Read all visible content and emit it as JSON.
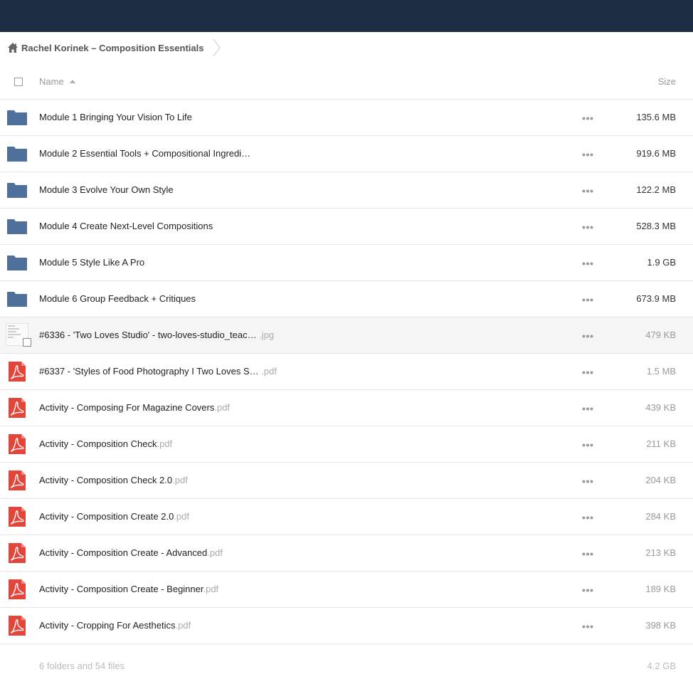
{
  "breadcrumb": {
    "label": "Rachel Korinek – Composition Essentials"
  },
  "header": {
    "name_label": "Name",
    "size_label": "Size"
  },
  "items": [
    {
      "kind": "folder",
      "name": "Module 1 Bringing Your Vision To Life",
      "ext": "",
      "size": "135.6 MB"
    },
    {
      "kind": "folder",
      "name": "Module 2 Essential Tools + Compositional Ingredi…",
      "ext": "",
      "size": "919.6 MB"
    },
    {
      "kind": "folder",
      "name": "Module 3 Evolve Your Own Style",
      "ext": "",
      "size": "122.2 MB"
    },
    {
      "kind": "folder",
      "name": "Module 4 Create Next-Level Compositions",
      "ext": "",
      "size": "528.3 MB"
    },
    {
      "kind": "folder",
      "name": "Module 5 Style Like A Pro",
      "ext": "",
      "size": "1.9 GB"
    },
    {
      "kind": "folder",
      "name": "Module 6 Group Feedback + Critiques",
      "ext": "",
      "size": "673.9 MB"
    },
    {
      "kind": "image",
      "name": "#6336 - 'Two Loves Studio' - two-loves-studio_teac… ",
      "ext": ".jpg",
      "size": "479 KB"
    },
    {
      "kind": "pdf",
      "name": "#6337 - 'Styles of Food Photography I Two Loves S… ",
      "ext": ".pdf",
      "size": "1.5 MB"
    },
    {
      "kind": "pdf",
      "name": "Activity - Composing For Magazine Covers",
      "ext": ".pdf",
      "size": "439 KB"
    },
    {
      "kind": "pdf",
      "name": "Activity - Composition Check",
      "ext": ".pdf",
      "size": "211 KB"
    },
    {
      "kind": "pdf",
      "name": "Activity - Composition Check 2.0",
      "ext": ".pdf",
      "size": "204 KB"
    },
    {
      "kind": "pdf",
      "name": "Activity - Composition Create 2.0",
      "ext": ".pdf",
      "size": "284 KB"
    },
    {
      "kind": "pdf",
      "name": "Activity - Composition Create - Advanced",
      "ext": ".pdf",
      "size": "213 KB"
    },
    {
      "kind": "pdf",
      "name": "Activity - Composition Create - Beginner",
      "ext": ".pdf",
      "size": "189 KB"
    },
    {
      "kind": "pdf",
      "name": "Activity - Cropping For Aesthetics",
      "ext": ".pdf",
      "size": "398 KB"
    }
  ],
  "footer": {
    "summary": "6 folders and 54 files",
    "total": "4.2 GB"
  },
  "colors": {
    "topbar": "#1d2d44",
    "folder": "#50709c",
    "pdf": "#e2463b"
  }
}
